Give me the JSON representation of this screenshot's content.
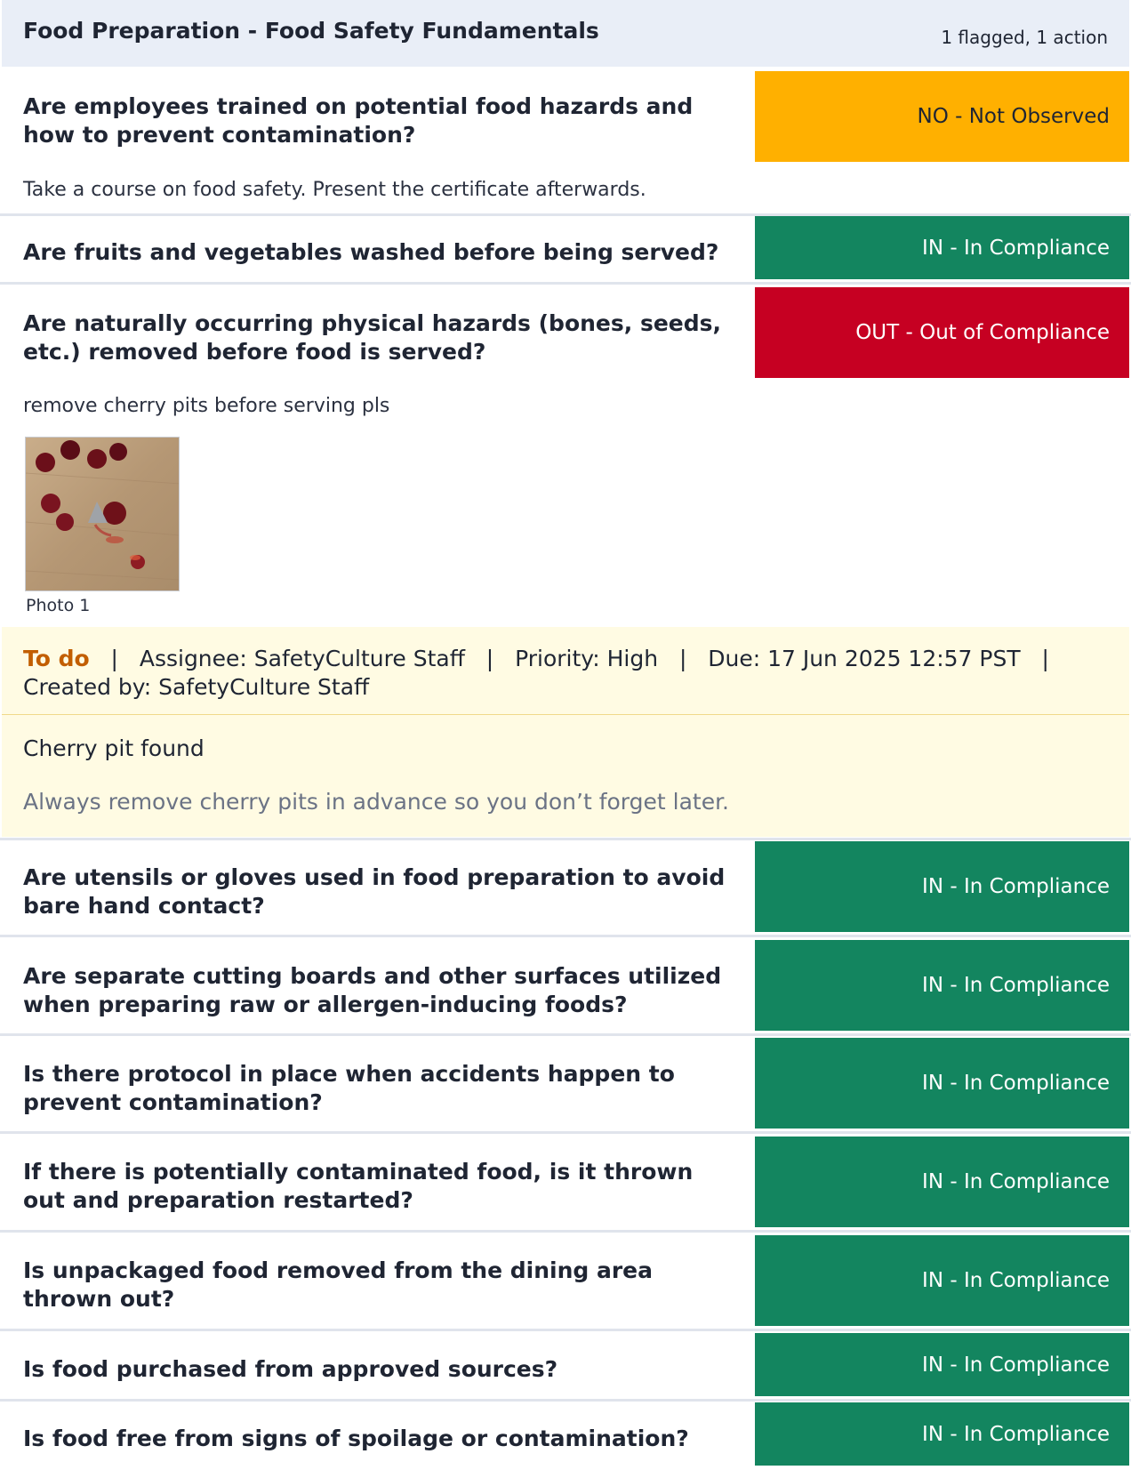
{
  "section": {
    "title": "Food Preparation - Food Safety Fundamentals",
    "summary": "1 flagged, 1 action"
  },
  "questions": [
    {
      "text": "Are employees trained on potential food hazards and how to prevent contamination?",
      "answer": "NO - Not Observed",
      "note": "Take a course on food safety. Present the certificate afterwards."
    },
    {
      "text": "Are fruits and vegetables washed before being served?",
      "answer": "IN - In Compliance"
    },
    {
      "text": "Are naturally occurring physical hazards (bones, seeds, etc.) removed before food is served?",
      "answer": "OUT - Out of Compliance",
      "note": "remove cherry pits before serving pls",
      "photo_caption": "Photo 1"
    },
    {
      "text": "Are utensils or gloves used in food preparation to avoid bare hand contact?",
      "answer": "IN - In Compliance"
    },
    {
      "text": "Are separate cutting boards and other surfaces utilized when preparing raw or allergen-inducing foods?",
      "answer": "IN - In Compliance"
    },
    {
      "text": "Is there protocol in place when accidents happen to prevent contamination?",
      "answer": "IN - In Compliance"
    },
    {
      "text": "If there is potentially contaminated food, is it thrown out and preparation restarted?",
      "answer": "IN - In Compliance"
    },
    {
      "text": "Is unpackaged food removed from the dining area thrown out?",
      "answer": "IN - In Compliance"
    },
    {
      "text": "Is food purchased from approved sources?",
      "answer": "IN - In Compliance"
    },
    {
      "text": "Is food free from signs of spoilage or contamination?",
      "answer": "IN - In Compliance"
    }
  ],
  "action": {
    "status": "To do",
    "separator": "|",
    "assignee": "Assignee: SafetyCulture Staff",
    "priority": "Priority: High",
    "due": "Due: 17 Jun 2025 12:57 PST",
    "created_by": "Created by: SafetyCulture Staff",
    "title": "Cherry pit found",
    "description": "Always remove cherry pits in advance so you don’t forget later."
  },
  "colors": {
    "in_compliance": "#13855f",
    "out_of_compliance": "#c60022",
    "not_observed": "#ffb000",
    "action_status": "#c25e00",
    "action_background": "#fffbe3"
  }
}
